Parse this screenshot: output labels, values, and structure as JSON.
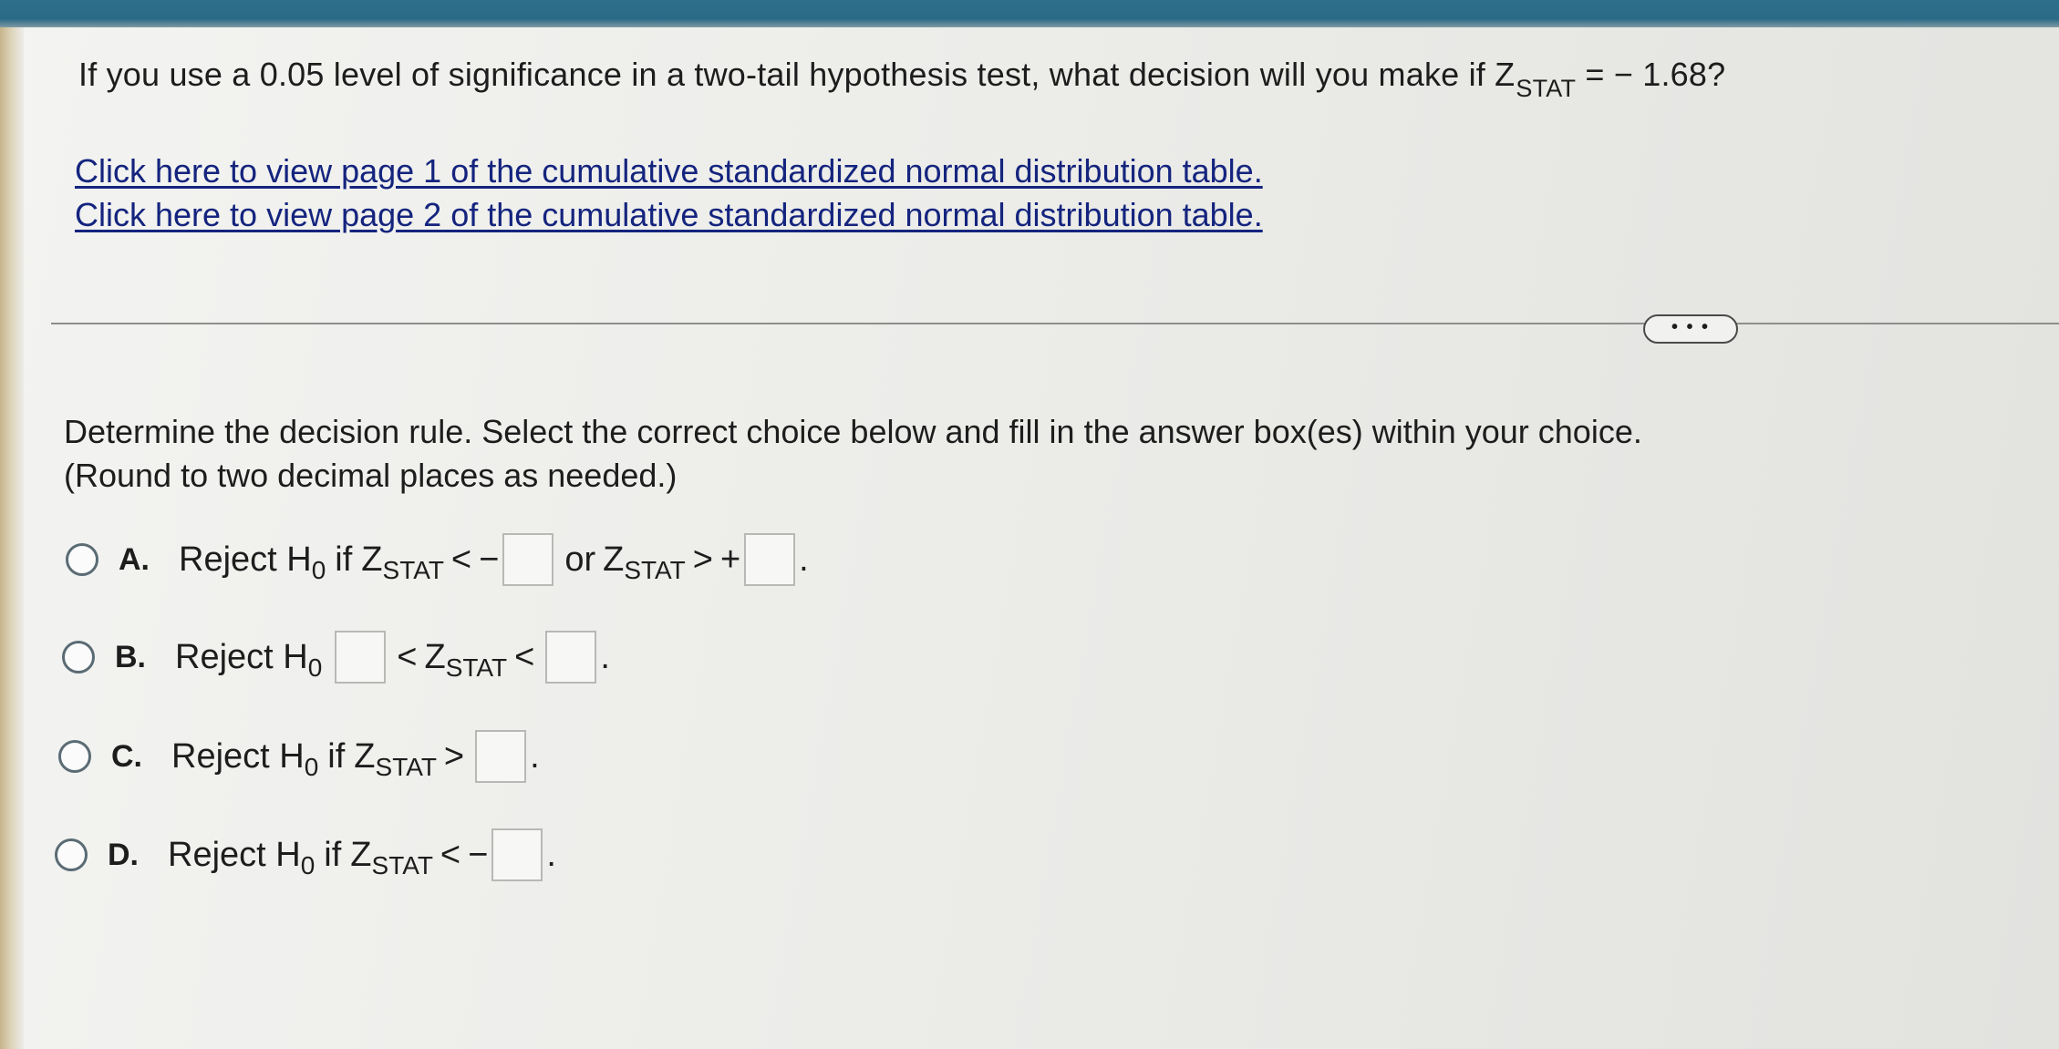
{
  "question": {
    "text_before": "If you use a 0.05 level of significance in a two-tail hypothesis test, what decision will you make if Z",
    "sub": "STAT",
    "text_after": " = − 1.68?"
  },
  "links": [
    "Click here to view page 1 of the cumulative standardized normal distribution table.",
    "Click here to view page 2 of the cumulative standardized normal distribution table."
  ],
  "more_button_label": "• • •",
  "instructions": {
    "line1": "Determine the decision rule. Select the correct choice below and fill in the answer box(es) within your choice.",
    "line2": "(Round to two decimal places as needed.)"
  },
  "common": {
    "reject": "Reject H",
    "h_sub": "0",
    "if": "if",
    "z": "Z",
    "stat": "STAT",
    "or": "or",
    "lt": "<",
    "gt": ">",
    "minus": "−",
    "plus": "+",
    "period": "."
  },
  "choices": {
    "a": "A.",
    "b": "B.",
    "c": "C.",
    "d": "D."
  }
}
